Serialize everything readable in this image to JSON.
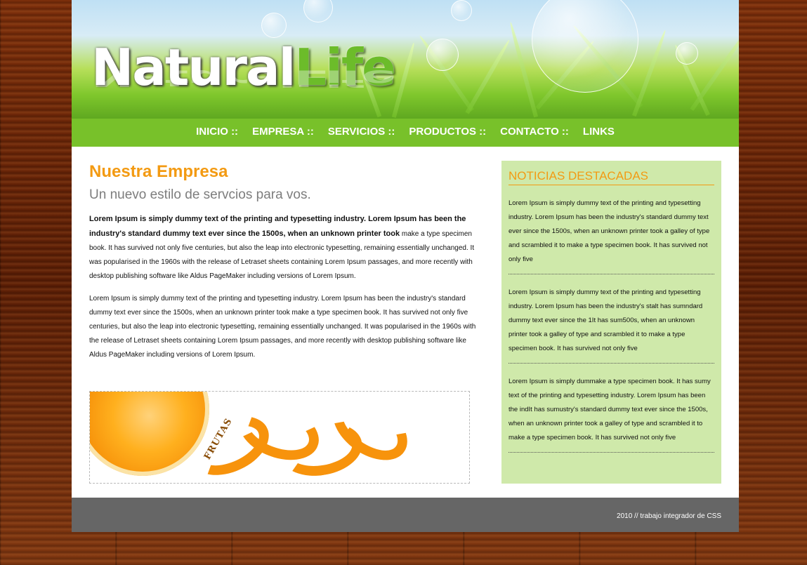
{
  "brand": {
    "part1": "Natural",
    "part2": "Life"
  },
  "nav": [
    {
      "label": "INICIO ::"
    },
    {
      "label": "EMPRESA ::"
    },
    {
      "label": "SERVICIOS ::"
    },
    {
      "label": "PRODUCTOS ::"
    },
    {
      "label": "CONTACTO ::"
    },
    {
      "label": "LINKS"
    }
  ],
  "main": {
    "title": "Nuestra Empresa",
    "subtitle": "Un nuevo estilo de servcios para vos.",
    "p1_bold": "Lorem Ipsum is simply dummy text of the printing and typesetting industry. Lorem Ipsum has been the industry's standard dummy text ever since the 1500s, when an unknown printer took",
    "p1_rest": " make a type specimen book. It has survived not only five centuries, but also the leap into electronic typesetting, remaining essentially unchanged. It was popularised in the 1960s with the release of Letraset sheets containing Lorem Ipsum passages, and more recently with desktop publishing software like Aldus PageMaker including versions of Lorem Ipsum.",
    "p2": "Lorem Ipsum is simply dummy text of the printing and typesetting industry. Lorem Ipsum has been the industry's standard dummy text ever since the 1500s, when an unknown printer took make a type specimen book. It has survived not only five centuries, but also the leap into electronic typesetting, remaining essentially unchanged. It was popularised in the 1960s with the release of Letraset sheets containing Lorem Ipsum passages, and more recently with desktop publishing software like Aldus PageMaker including versions of Lorem Ipsum.",
    "image_label": "FRUTAS"
  },
  "sidebar": {
    "title": "NOTICIAS DESTACADAS",
    "items": [
      {
        "text": "Lorem Ipsum is simply dummy text of the printing and typesetting industry. Lorem Ipsum has been the industry's standard dummy text ever since the 1500s, when an unknown printer took a galley of type and scrambled it to make a type specimen book. It has survived not only five"
      },
      {
        "text": "Lorem Ipsum is simply dummy text of the printing and typesetting industry. Lorem Ipsum has been the industry's stalt has sumndard dummy text ever since the 1It has sum500s, when an unknown printer took a galley of type and scrambled it to make a type specimen book. It has survived not only five"
      },
      {
        "text": "Lorem Ipsum is simply dummake a type specimen book. It has sumy text of the printing and typesetting industry. Lorem Ipsum has been the indIt has sumustry's standard dummy text ever since the 1500s, when an unknown printer took a galley of type and scrambled it to make a type specimen book. It has survived not only five"
      }
    ]
  },
  "footer": {
    "text": "2010 // trabajo integrador de CSS"
  },
  "colors": {
    "green": "#78c12a",
    "orange": "#f39a12",
    "sidebar_bg": "#cfe9aa",
    "footer_bg": "#666666"
  }
}
